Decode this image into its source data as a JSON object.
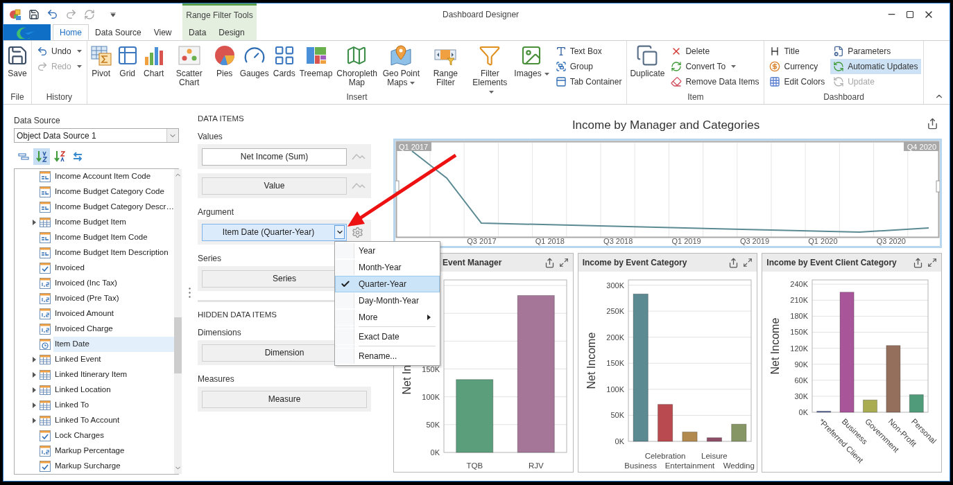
{
  "window": {
    "title": "Dashboard Designer"
  },
  "contextual_group": {
    "title": "Range Filter Tools"
  },
  "tabs": [
    {
      "label": "Home",
      "selected": true,
      "contextual": false
    },
    {
      "label": "Data Source",
      "selected": false,
      "contextual": false
    },
    {
      "label": "View",
      "selected": false,
      "contextual": false
    },
    {
      "label": "Data",
      "selected": false,
      "contextual": true
    },
    {
      "label": "Design",
      "selected": false,
      "contextual": true
    }
  ],
  "ribbon": [
    {
      "label": "File",
      "items": [
        {
          "label": "Save",
          "kind": "large",
          "dropdown": false,
          "disabled": false,
          "selected": false
        }
      ]
    },
    {
      "label": "History",
      "items": [
        {
          "label": "Undo",
          "kind": "small",
          "dropdown": true,
          "disabled": false,
          "selected": false
        },
        {
          "label": "Redo",
          "kind": "small",
          "dropdown": true,
          "disabled": true,
          "selected": false
        }
      ]
    },
    {
      "label": "Insert",
      "items": [
        {
          "label": "Pivot",
          "kind": "large",
          "dropdown": false,
          "disabled": false,
          "selected": false
        },
        {
          "label": "Grid",
          "kind": "large",
          "dropdown": false,
          "disabled": false,
          "selected": false
        },
        {
          "label": "Chart",
          "kind": "large",
          "dropdown": false,
          "disabled": false,
          "selected": false
        },
        {
          "label": "Scatter Chart",
          "kind": "large",
          "dropdown": false,
          "disabled": false,
          "selected": false
        },
        {
          "label": "Pies",
          "kind": "large",
          "dropdown": false,
          "disabled": false,
          "selected": false
        },
        {
          "label": "Gauges",
          "kind": "large",
          "dropdown": false,
          "disabled": false,
          "selected": false
        },
        {
          "label": "Cards",
          "kind": "large",
          "dropdown": false,
          "disabled": false,
          "selected": false
        },
        {
          "label": "Treemap",
          "kind": "large",
          "dropdown": false,
          "disabled": false,
          "selected": false
        },
        {
          "label": "Choropleth Map",
          "kind": "large",
          "dropdown": false,
          "disabled": false,
          "selected": false
        },
        {
          "label": "Geo Point Maps",
          "kind": "large",
          "dropdown": true,
          "disabled": false,
          "selected": false
        },
        {
          "label": "Range Filter",
          "kind": "large",
          "dropdown": false,
          "disabled": false,
          "selected": false
        },
        {
          "label": "Filter Elements",
          "kind": "large",
          "dropdown": true,
          "disabled": false,
          "selected": false
        },
        {
          "label": "Images",
          "kind": "large",
          "dropdown": true,
          "disabled": false,
          "selected": false
        },
        {
          "label": "Text Box",
          "kind": "small",
          "dropdown": false,
          "disabled": false,
          "selected": false
        },
        {
          "label": "Group",
          "kind": "small",
          "dropdown": false,
          "disabled": false,
          "selected": false
        },
        {
          "label": "Tab Container",
          "kind": "small",
          "dropdown": false,
          "disabled": false,
          "selected": false
        }
      ]
    },
    {
      "label": "Item",
      "items": [
        {
          "label": "Duplicate",
          "kind": "large",
          "dropdown": false,
          "disabled": false,
          "selected": false
        },
        {
          "label": "Delete",
          "kind": "small",
          "dropdown": false,
          "disabled": false,
          "selected": false
        },
        {
          "label": "Convert To",
          "kind": "small",
          "dropdown": true,
          "disabled": false,
          "selected": false
        },
        {
          "label": "Remove Data Items",
          "kind": "small",
          "dropdown": false,
          "disabled": false,
          "selected": false
        }
      ]
    },
    {
      "label": "Dashboard",
      "items": [
        {
          "label": "Title",
          "kind": "small",
          "dropdown": false,
          "disabled": false,
          "selected": false
        },
        {
          "label": "Currency",
          "kind": "small",
          "dropdown": false,
          "disabled": false,
          "selected": false
        },
        {
          "label": "Edit Colors",
          "kind": "small",
          "dropdown": false,
          "disabled": false,
          "selected": false
        },
        {
          "label": "Parameters",
          "kind": "small",
          "dropdown": false,
          "disabled": false,
          "selected": false
        },
        {
          "label": "Automatic Updates",
          "kind": "small",
          "dropdown": false,
          "disabled": false,
          "selected": true
        },
        {
          "label": "Update",
          "kind": "small",
          "dropdown": false,
          "disabled": true,
          "selected": false
        }
      ]
    }
  ],
  "field_list": {
    "label": "Data Source",
    "source": "Object Data Source 1",
    "toolbar": [
      {
        "selected": false
      },
      {
        "selected": true
      },
      {
        "selected": false
      },
      {
        "selected": false
      }
    ],
    "items": [
      {
        "label": "Income Account Item Code",
        "kind": "text",
        "selected": false
      },
      {
        "label": "Income Budget Category Code",
        "kind": "text",
        "selected": false
      },
      {
        "label": "Income Budget Category Descr…",
        "kind": "text",
        "selected": false
      },
      {
        "label": "Income Budget Item",
        "kind": "table",
        "selected": false
      },
      {
        "label": "Income Budget Item Code",
        "kind": "text",
        "selected": false
      },
      {
        "label": "Income Budget Item Description",
        "kind": "text",
        "selected": false
      },
      {
        "label": "Invoiced",
        "kind": "check",
        "selected": false
      },
      {
        "label": "Invoiced (Inc Tax)",
        "kind": "number",
        "selected": false
      },
      {
        "label": "Invoiced (Pre Tax)",
        "kind": "number",
        "selected": false
      },
      {
        "label": "Invoiced Amount",
        "kind": "number",
        "selected": false
      },
      {
        "label": "Invoiced Charge",
        "kind": "number",
        "selected": false
      },
      {
        "label": "Item Date",
        "kind": "date",
        "selected": true
      },
      {
        "label": "Linked Event",
        "kind": "table",
        "selected": false
      },
      {
        "label": "Linked Itinerary Item",
        "kind": "table",
        "selected": false
      },
      {
        "label": "Linked Location",
        "kind": "table",
        "selected": false
      },
      {
        "label": "Linked To",
        "kind": "table",
        "selected": false
      },
      {
        "label": "Linked To Account",
        "kind": "table",
        "selected": false
      },
      {
        "label": "Lock Charges",
        "kind": "check",
        "selected": false
      },
      {
        "label": "Markup Percentage",
        "kind": "number",
        "selected": false
      },
      {
        "label": "Markup Surcharge",
        "kind": "check",
        "selected": false
      }
    ]
  },
  "data_items": {
    "title": "DATA ITEMS",
    "sections": [
      {
        "label": "Values",
        "items": [
          {
            "label": "Net Income (Sum)",
            "kind": "measure",
            "bound": true,
            "selected": false
          },
          {
            "label": "Value",
            "kind": "measure",
            "bound": false,
            "selected": false
          }
        ]
      },
      {
        "label": "Argument",
        "items": [
          {
            "label": "Item Date (Quarter-Year)",
            "kind": "dimension",
            "selected": true
          }
        ]
      },
      {
        "label": "Series",
        "items": [
          {
            "label": "Series",
            "kind": "placeholder",
            "bound": false,
            "selected": false
          }
        ]
      }
    ]
  },
  "hidden_data_items": {
    "title": "HIDDEN DATA ITEMS",
    "sections": [
      {
        "label": "Dimensions",
        "items": [
          {
            "label": "Dimension",
            "kind": "placeholder",
            "bound": false,
            "selected": false
          }
        ]
      },
      {
        "label": "Measures",
        "items": [
          {
            "label": "Measure",
            "kind": "placeholder",
            "bound": false,
            "selected": false
          }
        ]
      }
    ]
  },
  "menu": {
    "items": [
      {
        "kind": "item",
        "label": "Year",
        "checked": false,
        "selected": false,
        "submenu": false
      },
      {
        "kind": "item",
        "label": "Month-Year",
        "checked": false,
        "selected": false,
        "submenu": false
      },
      {
        "kind": "item",
        "label": "Quarter-Year",
        "checked": true,
        "selected": true,
        "submenu": false
      },
      {
        "kind": "item",
        "label": "Day-Month-Year",
        "checked": false,
        "selected": false,
        "submenu": false
      },
      {
        "kind": "item",
        "label": "More",
        "checked": false,
        "selected": false,
        "submenu": true
      },
      {
        "kind": "separator"
      },
      {
        "kind": "item",
        "label": "Exact Date",
        "checked": false,
        "selected": false,
        "submenu": false
      },
      {
        "kind": "separator"
      },
      {
        "kind": "item",
        "label": "Rename...",
        "checked": false,
        "selected": false,
        "submenu": false
      }
    ]
  },
  "dashboard": {
    "title": "Income by Manager and Categories",
    "range_filter": {
      "start_label": "Q1 2017",
      "end_label": "Q4 2020",
      "axis_labels": [
        "Q3 2017",
        "Q1 2018",
        "Q3 2018",
        "Q1 2019",
        "Q3 2019",
        "Q1 2020",
        "Q3 2020"
      ]
    },
    "cards": [
      {
        "title": "Event Manager",
        "chart_data": {
          "type": "bar",
          "grid": true,
          "ylabel": "Net In",
          "categories": [
            "TQB",
            "RJV"
          ],
          "stacked": true,
          "ylim": [
            0,
            310000
          ],
          "yticks": [
            {
              "value": 0,
              "label": "0K"
            },
            {
              "value": 50000,
              "label": "50K"
            },
            {
              "value": 100000,
              "label": "100K"
            },
            {
              "value": 150000,
              "label": "150K"
            }
          ],
          "series": [
            {
              "color": "#5a9e7c",
              "values": [
                131000,
                null
              ]
            },
            {
              "color": "#a57698",
              "values": [
                null,
                282000
              ]
            }
          ]
        }
      },
      {
        "title": "Income by Event Category",
        "chart_data": {
          "type": "bar",
          "grid": true,
          "ylabel": "Net Income",
          "categories": [
            "Business",
            "Celebration",
            "Entertainment",
            "Leisure",
            "Wedding"
          ],
          "stacked": true,
          "ylim": [
            0,
            310000
          ],
          "yticks": [
            {
              "value": 0,
              "label": "0K"
            },
            {
              "value": 50000,
              "label": "50K"
            },
            {
              "value": 100000,
              "label": "100K"
            },
            {
              "value": 150000,
              "label": "150K"
            },
            {
              "value": 200000,
              "label": "200K"
            },
            {
              "value": 250000,
              "label": "250K"
            },
            {
              "value": 300000,
              "label": "300K"
            }
          ],
          "series": [
            {
              "color": "#5b8a93",
              "values": [
                283000,
                null,
                null,
                null,
                null
              ]
            },
            {
              "color": "#b94b50",
              "values": [
                null,
                71000,
                null,
                null,
                null
              ]
            },
            {
              "color": "#b28a4f",
              "values": [
                null,
                null,
                18000,
                null,
                null
              ]
            },
            {
              "color": "#8f4e67",
              "values": [
                null,
                null,
                null,
                7000,
                null
              ]
            },
            {
              "color": "#869765",
              "values": [
                null,
                null,
                null,
                null,
                33000
              ]
            }
          ]
        }
      },
      {
        "title": "Income by Event Client Category",
        "chart_data": {
          "type": "bar",
          "grid": true,
          "ylabel": "Net Income",
          "categories": [
            "*Preferred Client",
            "Business",
            "Government",
            "Non-Profit",
            "Personal"
          ],
          "stacked": true,
          "ylim": [
            0,
            248000
          ],
          "yticks": [
            {
              "value": 0,
              "label": "0K"
            },
            {
              "value": 30000,
              "label": "30K"
            },
            {
              "value": 60000,
              "label": "60K"
            },
            {
              "value": 90000,
              "label": "90K"
            },
            {
              "value": 120000,
              "label": "120K"
            },
            {
              "value": 150000,
              "label": "150K"
            },
            {
              "value": 180000,
              "label": "180K"
            },
            {
              "value": 210000,
              "label": "210K"
            },
            {
              "value": 240000,
              "label": "240K"
            }
          ],
          "series": [
            {
              "color": "#5565a5",
              "values": [
                2000,
                null,
                null,
                null,
                null
              ]
            },
            {
              "color": "#a8559a",
              "values": [
                null,
                225000,
                null,
                null,
                null
              ]
            },
            {
              "color": "#a9ac51",
              "values": [
                null,
                null,
                23000,
                null,
                null
              ]
            },
            {
              "color": "#946f5c",
              "values": [
                null,
                null,
                null,
                125000,
                null
              ]
            },
            {
              "color": "#4f9b7a",
              "values": [
                null,
                null,
                null,
                null,
                33000
              ]
            }
          ]
        }
      }
    ]
  }
}
